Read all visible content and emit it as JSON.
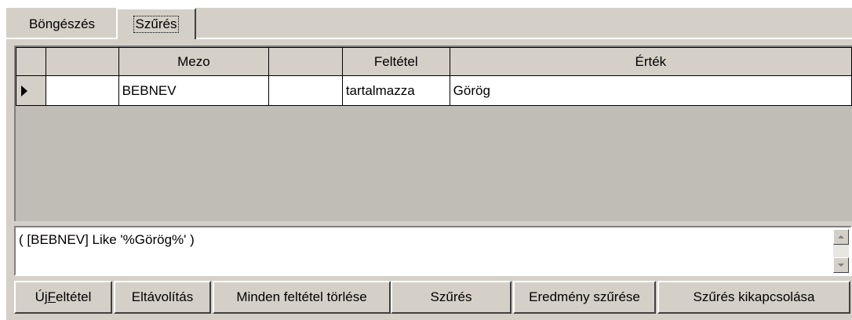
{
  "tabs": [
    {
      "label": "Böngészés",
      "active": false
    },
    {
      "label": "Szűrés",
      "active": true
    }
  ],
  "grid": {
    "columns": [
      "",
      "Mezo",
      "",
      "Feltétel",
      "Érték"
    ],
    "rows": [
      {
        "current": true,
        "cells": [
          "",
          "BEBNEV",
          "",
          "tartalmazza",
          "Görög"
        ]
      }
    ]
  },
  "filter_expression": "( [BEBNEV] Like '%Görög%' )",
  "buttons": {
    "new_condition_prefix": "Új ",
    "new_condition_accel": "F",
    "new_condition_rest": "eltétel",
    "remove": "Eltávolítás",
    "clear_all": "Minden feltétel törlése",
    "filter": "Szűrés",
    "filter_result": "Eredmény szűrése",
    "filter_off": "Szűrés kikapcsolása"
  },
  "colors": {
    "face": "#d4d0c8",
    "grid_bg": "#c0bcb6"
  },
  "icons": [
    "row-indicator-arrow-icon",
    "scroll-up-icon",
    "scroll-down-icon"
  ]
}
